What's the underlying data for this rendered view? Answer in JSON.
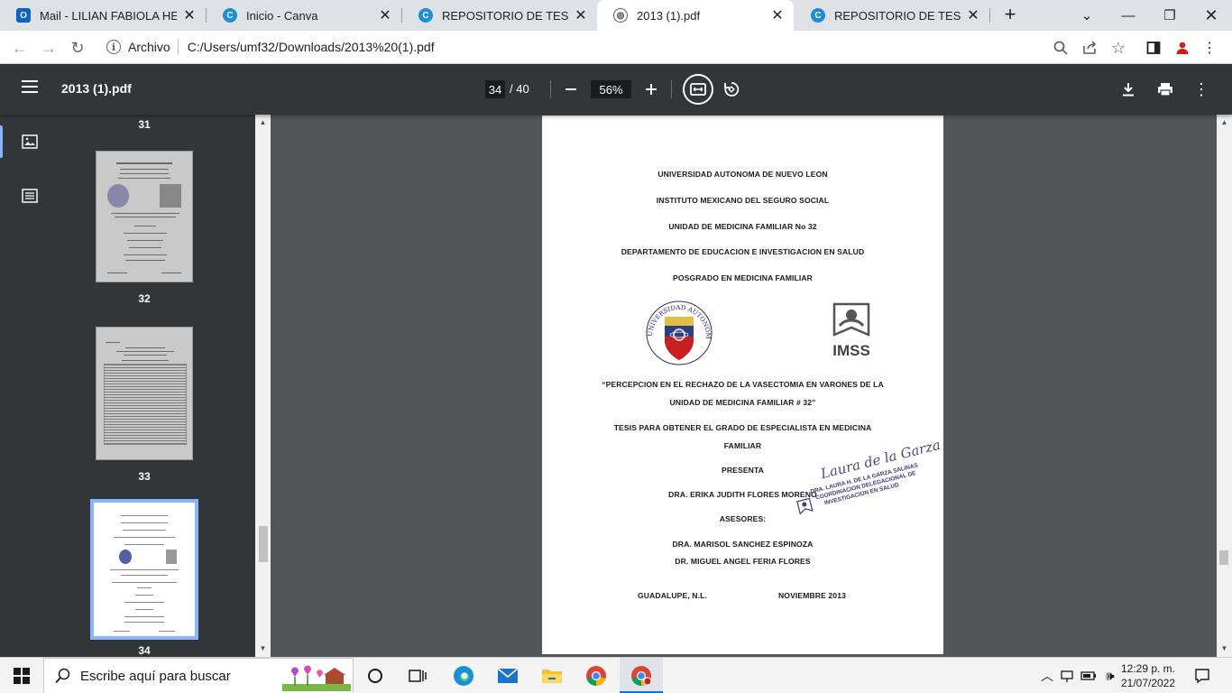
{
  "browser": {
    "tabs": [
      {
        "title": "Mail - LILIAN FABIOLA HERN",
        "icon": "outlook-icon"
      },
      {
        "title": "Inicio - Canva",
        "icon": "canva-icon"
      },
      {
        "title": "REPOSITORIO DE TESIS UMF",
        "icon": "canva-icon"
      },
      {
        "title": "2013 (1).pdf",
        "icon": "globe-icon"
      },
      {
        "title": "REPOSITORIO DE TESIS UMF",
        "icon": "canva-icon"
      }
    ],
    "new_tab": "+",
    "address": {
      "scheme": "Archivo",
      "url": "C:/Users/umf32/Downloads/2013%20(1).pdf"
    }
  },
  "pdf": {
    "title": "2013 (1).pdf",
    "current_page": "34",
    "total_pages": "/ 40",
    "zoom": "56%",
    "thumbnails": [
      {
        "label": "31"
      },
      {
        "label": "32"
      },
      {
        "label": "33"
      },
      {
        "label": "34"
      }
    ],
    "document": {
      "lines": [
        "UNIVERSIDAD AUTONOMA DE NUEVO LEON",
        "INSTITUTO MEXICANO DEL SEGURO SOCIAL",
        "UNIDAD DE MEDICINA FAMILIAR No 32",
        "DEPARTAMENTO DE EDUCACION E INVESTIGACION EN SALUD",
        "POSGRADO EN MEDICINA FAMILIAR"
      ],
      "logo_right_text": "IMSS",
      "thesis_title_1": "“PERCEPCION EN EL RECHAZO DE LA VASECTOMIA EN VARONES DE LA",
      "thesis_title_2": "UNIDAD DE MEDICINA FAMILIAR # 32”",
      "purpose_1": "TESIS PARA OBTENER EL GRADO DE ESPECIALISTA EN MEDICINA",
      "purpose_2": "FAMILIAR",
      "presenta": "PRESENTA",
      "author": "DRA. ERIKA JUDITH FLORES MORENO",
      "advisors_label": "ASESORES:",
      "advisor_1": "DRA. MARISOL SANCHEZ ESPINOZA",
      "advisor_2": "DR. MIGUEL ANGEL FERIA FLORES",
      "place": "GUADALUPE, N.L.",
      "date": "NOVIEMBRE 2013",
      "stamp_signature": "Laura de la Garza",
      "stamp_line_1": "DRA. LAURA H. DE LA GARZA SALINAS",
      "stamp_line_2": "COORDINACION DELEGACIONAL DE",
      "stamp_line_3": "INVESTIGACION EN SALUD"
    }
  },
  "taskbar": {
    "search_placeholder": "Escribe aquí para buscar",
    "time": "12:29 p. m.",
    "date": "21/07/2022"
  }
}
